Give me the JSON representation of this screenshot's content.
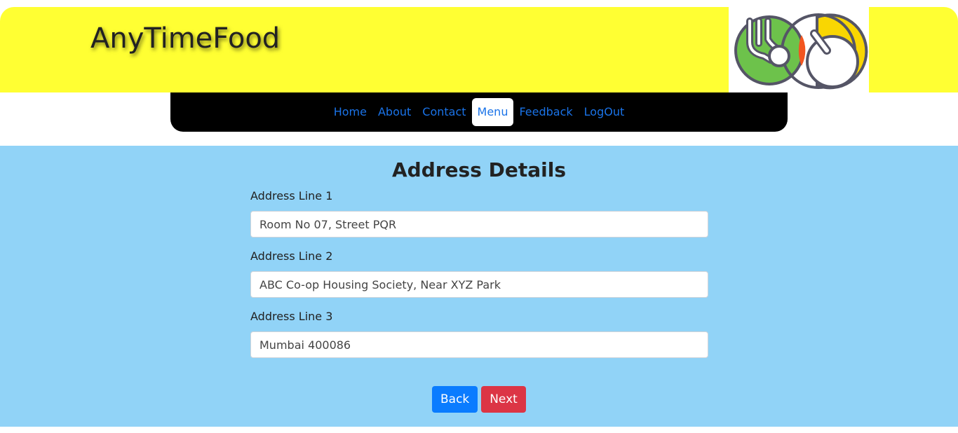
{
  "header": {
    "brand": "AnyTimeFood",
    "logo_icon": "fork-plate-logo-icon"
  },
  "nav": {
    "items": [
      {
        "label": "Home"
      },
      {
        "label": "About"
      },
      {
        "label": "Contact"
      },
      {
        "label": "Menu",
        "active": true
      },
      {
        "label": "Feedback"
      },
      {
        "label": "LogOut"
      }
    ]
  },
  "form": {
    "title": "Address Details",
    "fields": [
      {
        "label": "Address Line 1",
        "value": "Room No 07, Street PQR"
      },
      {
        "label": "Address Line 2",
        "value": "ABC Co-op Housing Society, Near XYZ Park"
      },
      {
        "label": "Address Line 3",
        "value": "Mumbai 400086"
      }
    ],
    "back_label": "Back",
    "next_label": "Next"
  },
  "colors": {
    "header_bg": "#ffff33",
    "nav_bg": "#000000",
    "nav_link": "#1a73e8",
    "main_bg": "#91d3f7",
    "back_button": "#0a7cff",
    "next_button": "#dc3545"
  }
}
